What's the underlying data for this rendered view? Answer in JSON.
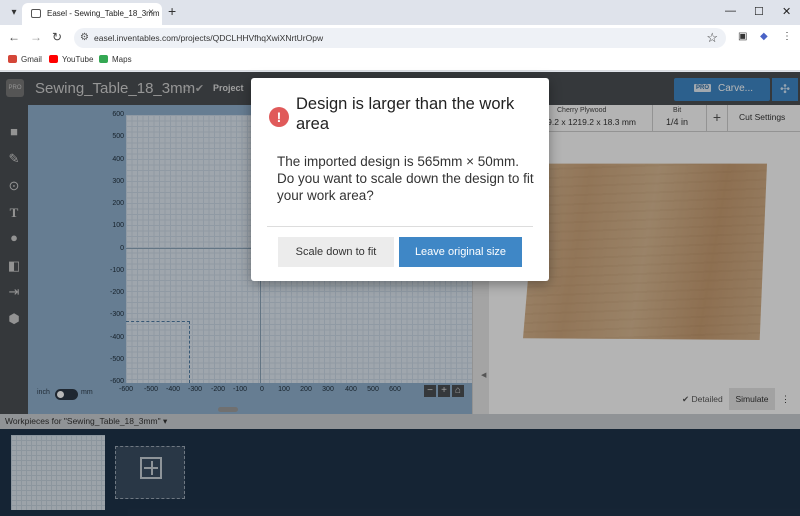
{
  "browser": {
    "tab_title": "Easel - Sewing_Table_18_3mm",
    "tab_close": "×",
    "new_tab": "+",
    "url": "easel.inventables.com/projects/QDCLHHVfhqXwiXNrtUrOpw",
    "bookmarks": [
      {
        "label": "Gmail",
        "color": "#d44638"
      },
      {
        "label": "YouTube",
        "color": "#ff0000"
      },
      {
        "label": "Maps",
        "color": "#34a853"
      }
    ]
  },
  "app": {
    "logo": "PRO",
    "project_name": "Sewing_Table_18_3mm",
    "project_menu": "Project",
    "carve_badge": "PRO",
    "carve_label": "Carve...",
    "units_inch": "inch",
    "units_mm": "mm",
    "y_ticks": [
      "600",
      "500",
      "400",
      "300",
      "200",
      "100",
      "0",
      "-100",
      "-200",
      "-300",
      "-400",
      "-500",
      "-600"
    ],
    "x_ticks": [
      "-600",
      "-500",
      "-400",
      "-300",
      "-200",
      "-100",
      "0",
      "100",
      "200",
      "300",
      "400",
      "500",
      "600"
    ],
    "material_name": "Cherry Plywood",
    "material_dims": "1219.2 x 1219.2 x 18.3 mm",
    "bit_label": "Bit",
    "bit_value": "1/4 in",
    "add_label": "+",
    "cut_settings": "Cut Settings",
    "detailed": "Detailed",
    "simulate": "Simulate",
    "workpieces_label": "Workpieces for \"Sewing_Table_18_3mm\""
  },
  "dialog": {
    "title": "Design is larger than the work area",
    "message": "The imported design is 565mm × 50mm. Do you want to scale down the design to fit your work area?",
    "scale_button": "Scale down to fit",
    "leave_button": "Leave original size"
  },
  "colors": {
    "accent": "#3f87c6",
    "warning": "#e05a5a"
  }
}
